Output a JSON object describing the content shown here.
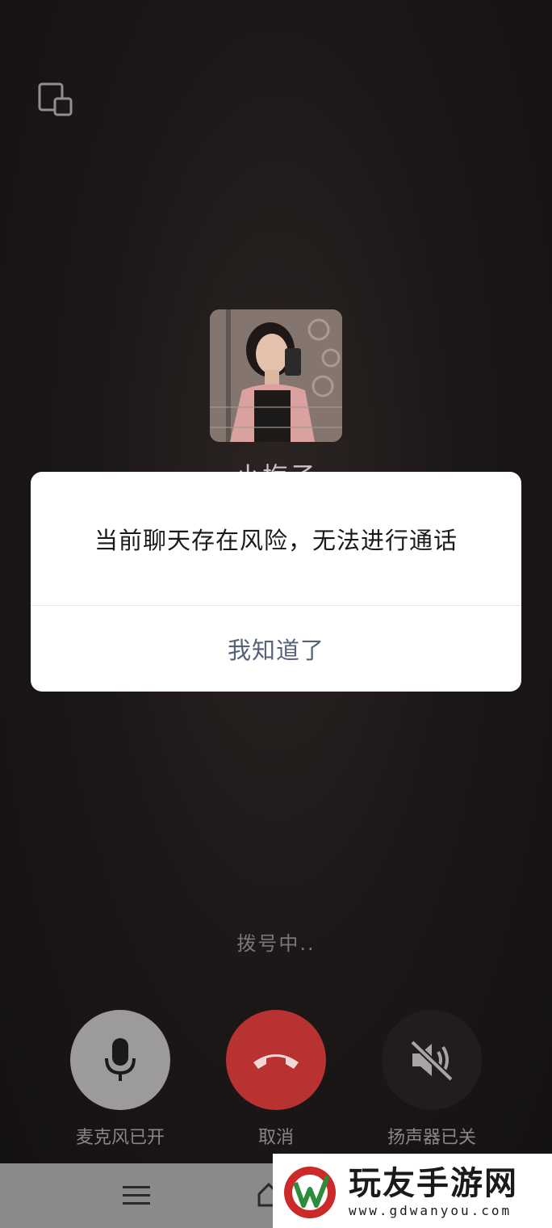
{
  "caller": {
    "name": "小梅子"
  },
  "dialog": {
    "message": "当前聊天存在风险，无法进行通话",
    "confirm_label": "我知道了"
  },
  "call": {
    "status": "拨号中.."
  },
  "controls": {
    "mic_label": "麦克风已开",
    "cancel_label": "取消",
    "speaker_label": "扬声器已关"
  },
  "watermark": {
    "title": "玩友手游网",
    "url": "www.gdwanyou.com"
  },
  "colors": {
    "hangup": "#b83232",
    "mic_bg": "#9d9a9a",
    "speaker_bg": "#211d1d",
    "brand_red": "#cc2a2a",
    "brand_green": "#2e8b3a"
  }
}
